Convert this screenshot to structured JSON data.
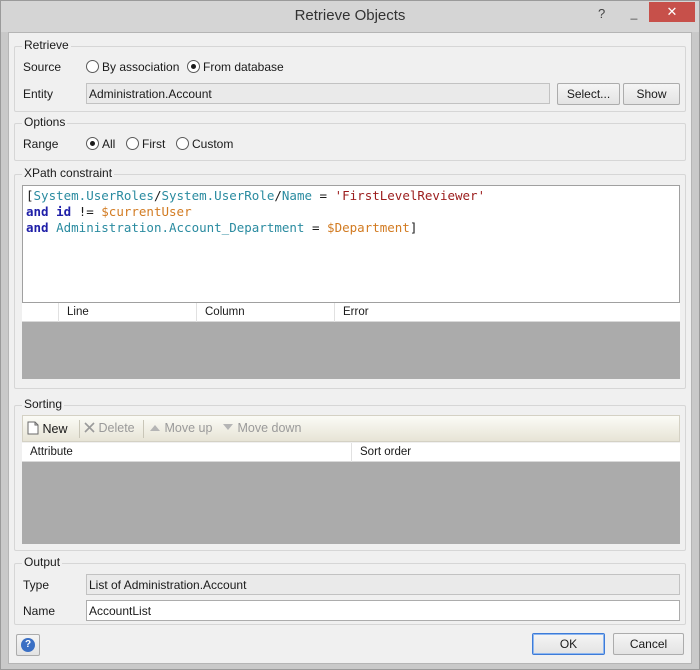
{
  "window": {
    "title": "Retrieve Objects",
    "help_glyph": "?",
    "minimize_glyph": "_",
    "close_glyph": "✕"
  },
  "retrieve": {
    "group_title": "Retrieve",
    "source_label": "Source",
    "source_options": [
      "By association",
      "From database"
    ],
    "source_selected": "From database",
    "entity_label": "Entity",
    "entity_value": "Administration.Account",
    "select_button": "Select...",
    "show_button": "Show"
  },
  "options": {
    "group_title": "Options",
    "range_label": "Range",
    "range_options": [
      "All",
      "First",
      "Custom"
    ],
    "range_selected": "All"
  },
  "xpath": {
    "group_title": "XPath constraint",
    "line1": {
      "open": "[",
      "path1": "System.UserRoles",
      "slash1": "/",
      "path2": "System.UserRole",
      "slash2": "/",
      "path3": "Name",
      "eq": " = ",
      "str": "'FirstLevelReviewer'"
    },
    "line2": {
      "kw": "and",
      "sp": " ",
      "attr": "id",
      "op": " != ",
      "var": "$currentUser"
    },
    "line3": {
      "kw": "and",
      "sp": " ",
      "path": "Administration.Account_Department",
      "op": " = ",
      "var": "$Department",
      "close": "]"
    },
    "error_columns": [
      "",
      "Line",
      "Column",
      "Error"
    ]
  },
  "sorting": {
    "group_title": "Sorting",
    "toolbar": {
      "new": "New",
      "delete": "Delete",
      "move_up": "Move up",
      "move_down": "Move down"
    },
    "columns": [
      "Attribute",
      "Sort order"
    ]
  },
  "output": {
    "group_title": "Output",
    "type_label": "Type",
    "type_value": "List of Administration.Account",
    "name_label": "Name",
    "name_value": "AccountList"
  },
  "footer": {
    "ok": "OK",
    "cancel": "Cancel",
    "help_glyph": "?"
  },
  "colors": {
    "keyword": "#1f1fa8",
    "path": "#2a8ba0",
    "string": "#9b1c1c",
    "variable": "#d27b22",
    "close_button": "#c7504a",
    "grid_empty": "#ababab"
  },
  "icons": {
    "new": "document-new-icon",
    "delete": "x-delete-icon",
    "move_up": "triangle-up-icon",
    "move_down": "triangle-down-icon",
    "help": "help-circle-icon"
  }
}
